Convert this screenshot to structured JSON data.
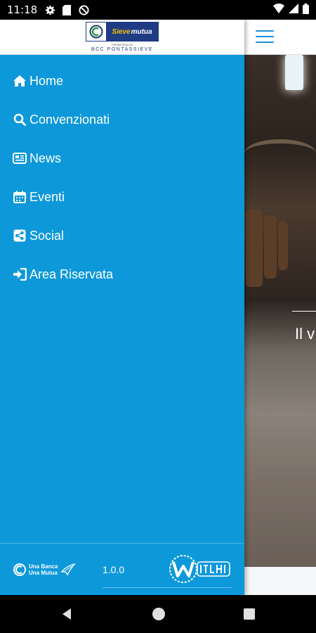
{
  "status_bar": {
    "time": "11:18",
    "left_icons": [
      "gear-icon",
      "sd-card-icon",
      "no-sync-icon"
    ],
    "right_icons": [
      "wifi-icon",
      "signal-icon",
      "battery-icon"
    ]
  },
  "header": {
    "logo": {
      "brand_accent": "Sieve",
      "brand_main": "mutua",
      "small_text": "PROMOSSA DA",
      "subtitle": "BCC PONTASSIEVE"
    },
    "menu_icon": "hamburger-icon"
  },
  "drawer": {
    "background_color": "#0d98da",
    "menu_items": [
      {
        "label": "Home",
        "icon": "home-icon"
      },
      {
        "label": "Convenzionati",
        "icon": "search-icon"
      },
      {
        "label": "News",
        "icon": "newspaper-icon"
      },
      {
        "label": "Eventi",
        "icon": "calendar-icon"
      },
      {
        "label": "Social",
        "icon": "share-icon"
      },
      {
        "label": "Area Riservata",
        "icon": "sign-in-icon"
      }
    ],
    "footer": {
      "brand_line1": "Una Banca",
      "brand_line2": "Una Mutua",
      "version": "1.0.0",
      "developer_logo": "witlab-logo"
    }
  },
  "background_content": {
    "hero_text": "Il v",
    "accent_color": "#1b8fd8"
  },
  "nav_bar": {
    "buttons": [
      "back-icon",
      "home-circle-icon",
      "recents-icon"
    ]
  }
}
